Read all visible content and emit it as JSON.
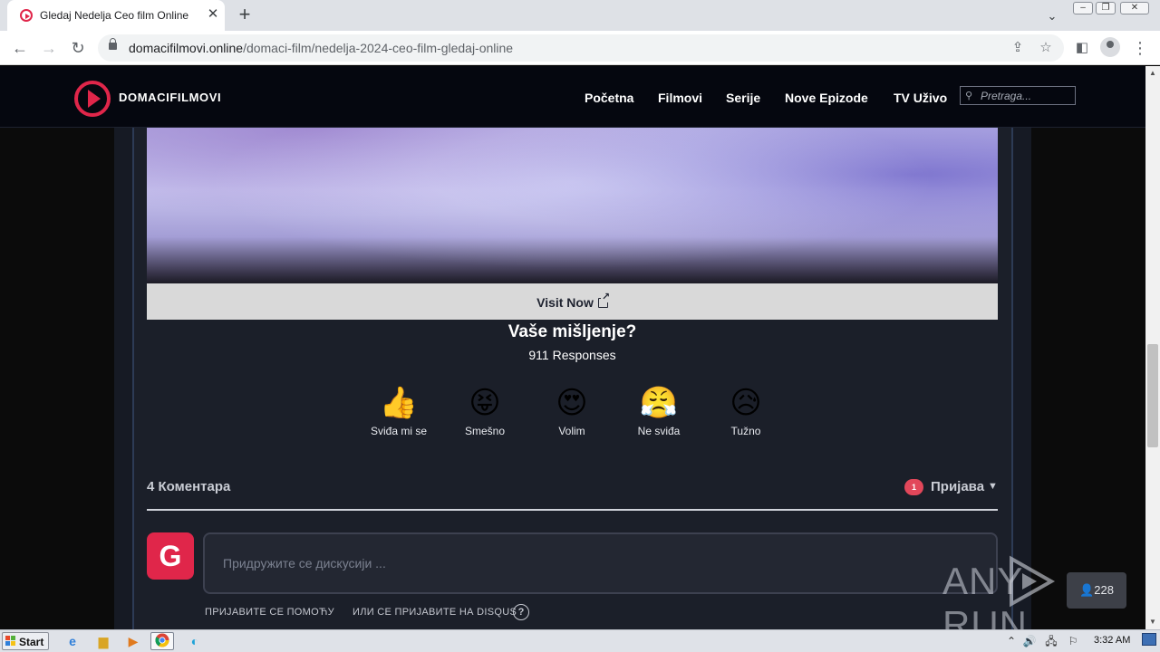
{
  "browser": {
    "tab_title": "Gledaj Nedelja Ceo film Online",
    "url_host": "domacifilmovi.online",
    "url_path": "/domaci-film/nedelja-2024-ceo-film-gledaj-online"
  },
  "site": {
    "logo_text": "DOMACIFILMOVI",
    "nav": [
      "Početna",
      "Filmovi",
      "Serije",
      "Nove Epizode",
      "TV Uživo"
    ],
    "search_placeholder": "Pretraga...",
    "brand_color": "#e0264a"
  },
  "ad": {
    "visit_label": "Visit Now"
  },
  "reactions": {
    "title": "Vaše mišljenje?",
    "responses": "911 Responses",
    "items": [
      {
        "emoji": "👍",
        "label": "Sviđa mi se"
      },
      {
        "emoji": "😝",
        "label": "Smešno"
      },
      {
        "emoji": "😍",
        "label": "Volim"
      },
      {
        "emoji": "😤",
        "label": "Ne sviđa"
      },
      {
        "emoji": "😥",
        "label": "Tužno"
      }
    ]
  },
  "comments": {
    "count_label": "4 Коментара",
    "notification_count": "1",
    "login_label": "Пријава",
    "avatar_letter": "G",
    "input_placeholder": "Придружите се дискусији ...",
    "login_with": "ПРИЈАВИТЕ СЕ ПОМОЋУ",
    "or_disqus": "ИЛИ СЕ ПРИЈАВИТЕ НА DISQUS",
    "help_glyph": "?"
  },
  "watermark": {
    "text_left": "ANY",
    "text_right": "RUN",
    "online_count": "228"
  },
  "taskbar": {
    "start_label": "Start",
    "clock": "3:32 AM"
  }
}
